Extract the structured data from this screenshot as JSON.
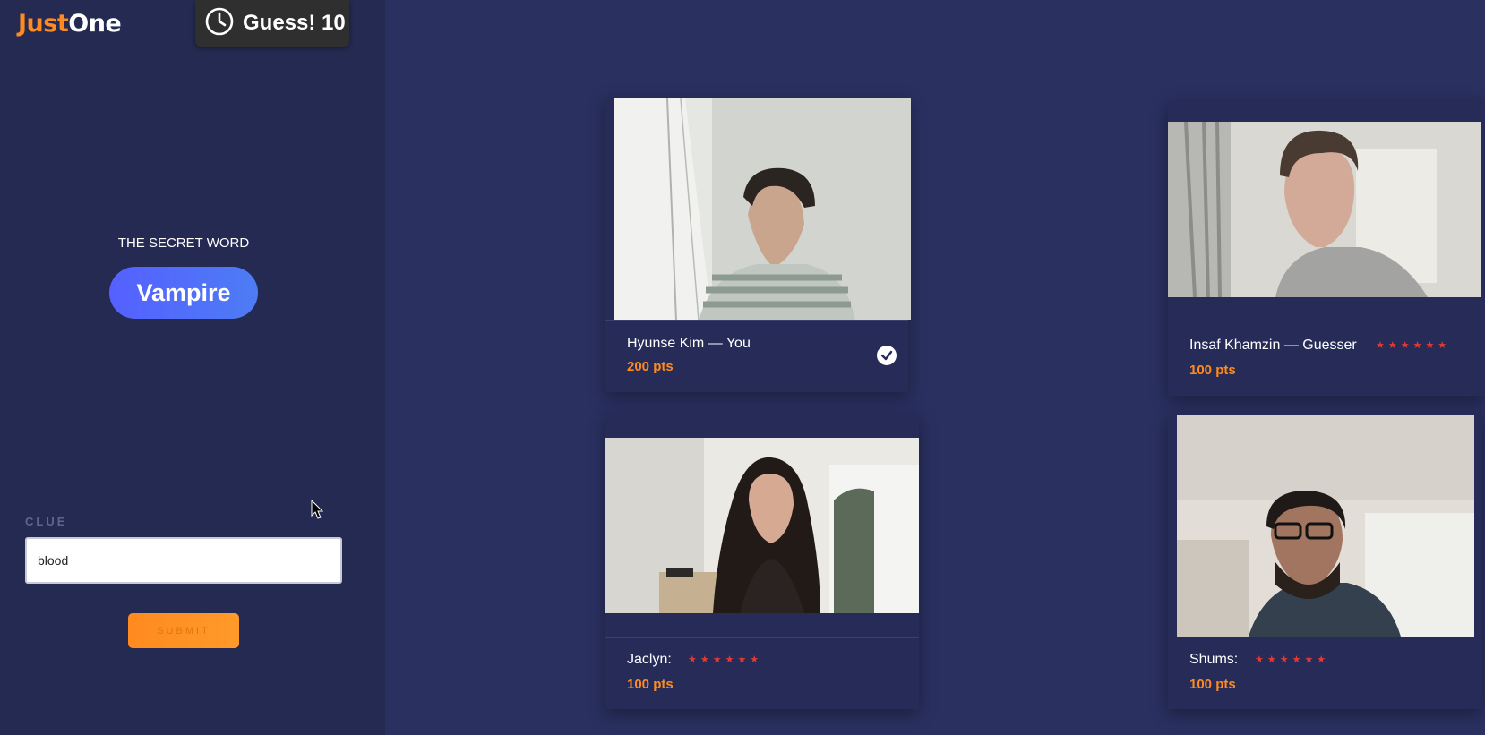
{
  "app": {
    "logo_part1": "Just",
    "logo_part2": "One"
  },
  "timer": {
    "label": "Guess! 10",
    "icon": "clock-icon"
  },
  "secret": {
    "label": "THE SECRET WORD",
    "word": "Vampire"
  },
  "clue": {
    "label": "CLUE",
    "value": "blood",
    "submit_label": "SUBMIT"
  },
  "players": [
    {
      "name": "Hyunse Kim — You",
      "points": "200 pts",
      "status": "submitted"
    },
    {
      "name": "Insaf Khamzin — Guesser",
      "points": "100 pts",
      "stars": "★★★★★★"
    },
    {
      "name": "Jaclyn:",
      "points": "100 pts",
      "stars": "★★★★★★"
    },
    {
      "name": "Shums:",
      "points": "100 pts",
      "stars": "★★★★★★"
    }
  ],
  "colors": {
    "accent": "#ff8a1f",
    "secret_badge": "#5560ff",
    "background": "#2a3060",
    "sidebar": "#252a52",
    "stars": "#e53935"
  }
}
